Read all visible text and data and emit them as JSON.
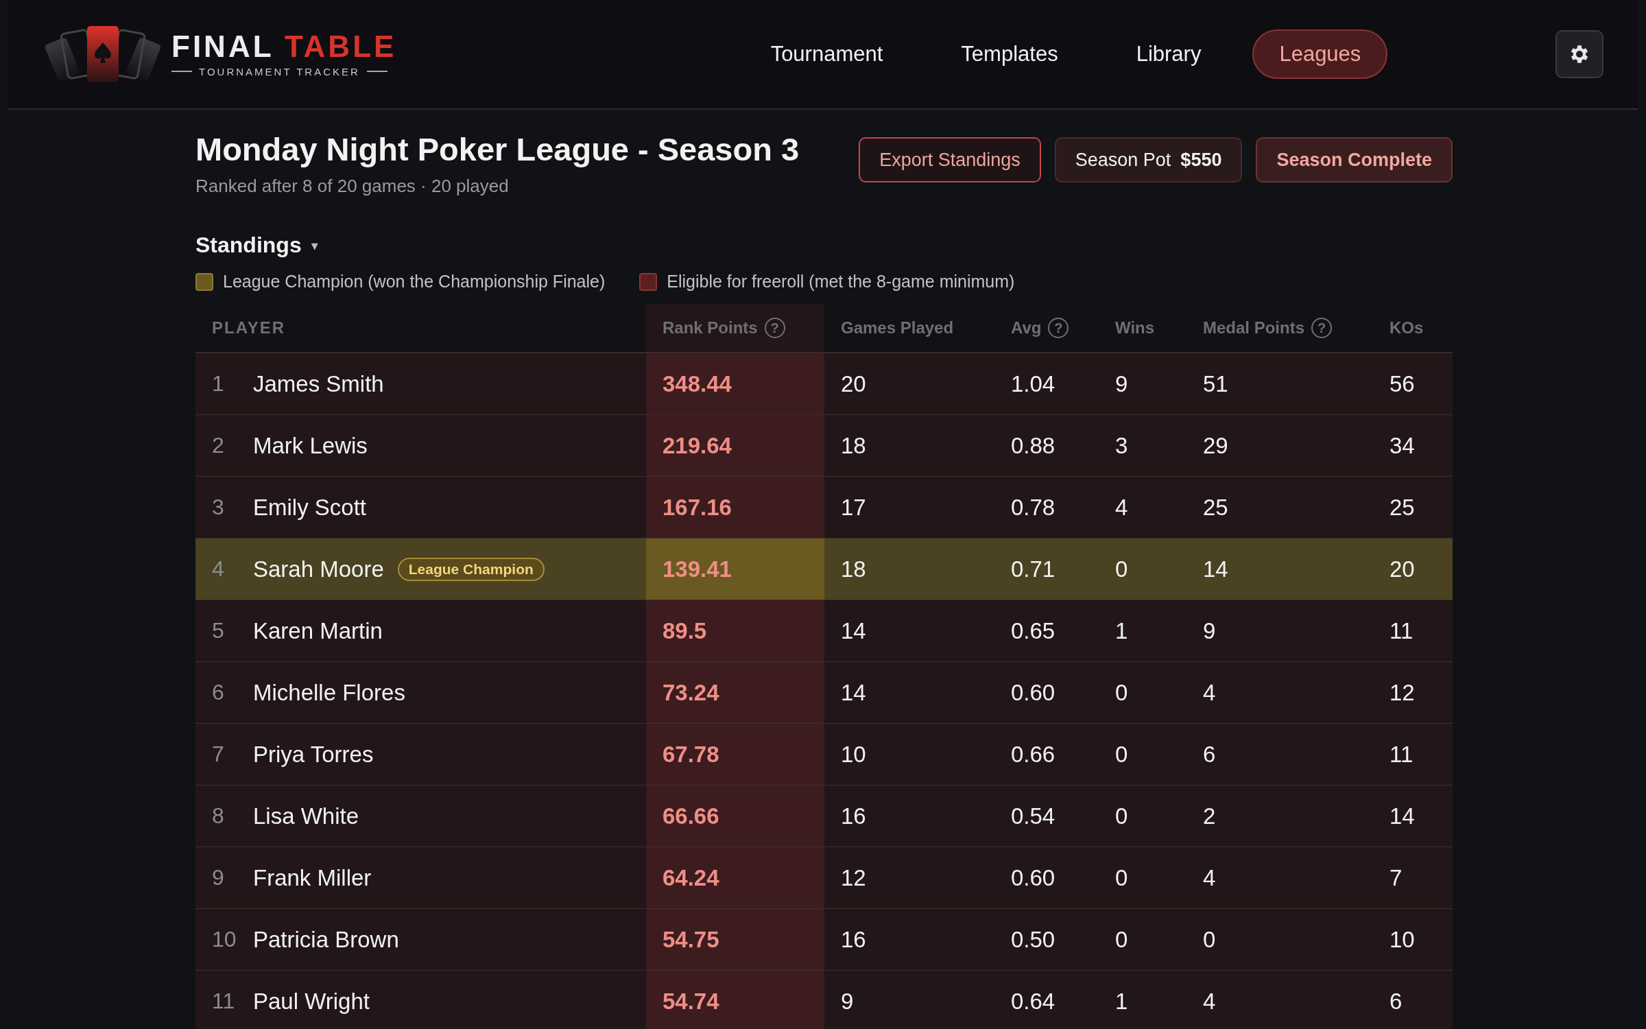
{
  "logo": {
    "word_1": "FINAL",
    "word_2": "TABLE",
    "tagline": "TOURNAMENT TRACKER"
  },
  "nav": [
    {
      "label": "Tournament",
      "selected": false
    },
    {
      "label": "Templates",
      "selected": false
    },
    {
      "label": "Library",
      "selected": false
    },
    {
      "label": "Leagues",
      "selected": true
    }
  ],
  "header": {
    "title": "Monday Night Poker League - Season 3",
    "subtitle": "Ranked after 8 of 20 games · 20 played"
  },
  "actions": [
    {
      "kind": "outline",
      "label": "Export Standings"
    },
    {
      "kind": "pot",
      "label": "Season Pot",
      "value": "$550"
    },
    {
      "kind": "status",
      "label": "Season Complete"
    }
  ],
  "section": {
    "title": "Standings",
    "caret": "▾"
  },
  "legend": [
    {
      "label": "League Champion (won the Championship Finale)",
      "color": "#6b5a1e"
    },
    {
      "label": "Eligible for freeroll (met the 8-game minimum)",
      "color": "#5a2020"
    }
  ],
  "table": {
    "columns": [
      {
        "label": "PLAYER"
      },
      {
        "label": "Rank Points",
        "help": "?"
      },
      {
        "label": "Games Played"
      },
      {
        "label": "Avg",
        "help": "?"
      },
      {
        "label": "Wins"
      },
      {
        "label": "Medal Points",
        "help": "?"
      },
      {
        "label": "KOs"
      }
    ],
    "rows": [
      {
        "rank": "1",
        "player": "James Smith",
        "kind": "eligible",
        "points": "348.44",
        "games": "20",
        "avg": "1.04",
        "wins": "9",
        "medal": "51",
        "kos": "56"
      },
      {
        "rank": "2",
        "player": "Mark Lewis",
        "kind": "eligible",
        "points": "219.64",
        "games": "18",
        "avg": "0.88",
        "wins": "3",
        "medal": "29",
        "kos": "34"
      },
      {
        "rank": "3",
        "player": "Emily Scott",
        "kind": "eligible",
        "points": "167.16",
        "games": "17",
        "avg": "0.78",
        "wins": "4",
        "medal": "25",
        "kos": "25"
      },
      {
        "rank": "4",
        "player": "Sarah Moore",
        "kind": "champion",
        "badge": "League Champion",
        "points": "139.41",
        "games": "18",
        "avg": "0.71",
        "wins": "0",
        "medal": "14",
        "kos": "20"
      },
      {
        "rank": "5",
        "player": "Karen Martin",
        "kind": "eligible",
        "points": "89.5",
        "games": "14",
        "avg": "0.65",
        "wins": "1",
        "medal": "9",
        "kos": "11"
      },
      {
        "rank": "6",
        "player": "Michelle Flores",
        "kind": "eligible",
        "points": "73.24",
        "games": "14",
        "avg": "0.60",
        "wins": "0",
        "medal": "4",
        "kos": "12"
      },
      {
        "rank": "7",
        "player": "Priya Torres",
        "kind": "eligible",
        "points": "67.78",
        "games": "10",
        "avg": "0.66",
        "wins": "0",
        "medal": "6",
        "kos": "11"
      },
      {
        "rank": "8",
        "player": "Lisa White",
        "kind": "eligible",
        "points": "66.66",
        "games": "16",
        "avg": "0.54",
        "wins": "0",
        "medal": "2",
        "kos": "14"
      },
      {
        "rank": "9",
        "player": "Frank Miller",
        "kind": "eligible",
        "points": "64.24",
        "games": "12",
        "avg": "0.60",
        "wins": "0",
        "medal": "4",
        "kos": "7"
      },
      {
        "rank": "10",
        "player": "Patricia Brown",
        "kind": "eligible",
        "points": "54.75",
        "games": "16",
        "avg": "0.50",
        "wins": "0",
        "medal": "0",
        "kos": "10"
      },
      {
        "rank": "11",
        "player": "Paul Wright",
        "kind": "eligible",
        "points": "54.74",
        "games": "9",
        "avg": "0.64",
        "wins": "1",
        "medal": "4",
        "kos": "6"
      }
    ]
  }
}
